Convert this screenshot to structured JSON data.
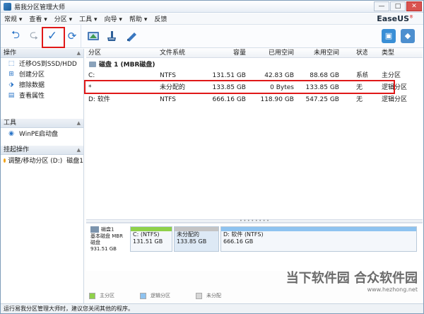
{
  "window": {
    "title": "易我分区管理大师",
    "controls": [
      "—",
      "□",
      "✕"
    ]
  },
  "menu": [
    "常规 ▾",
    "查看 ▾",
    "分区 ▾",
    "工具 ▾",
    "向导 ▾",
    "帮助 ▾",
    "反馈"
  ],
  "brand": {
    "name": "EaseUS",
    "mark": "®"
  },
  "toolbar": {
    "undo": "⮌",
    "redo": "⮎",
    "apply": "✓",
    "refresh": "⟳",
    "icons": [
      "partition-icon",
      "wipe-icon",
      "settings-icon"
    ],
    "right_icons": [
      "upgrade-icon",
      "info-icon"
    ]
  },
  "sidebar": {
    "operations_header": "操作",
    "operations": [
      {
        "icon": "migrate-icon",
        "label": "迁移OS到SSD/HDD"
      },
      {
        "icon": "create-icon",
        "label": "创建分区"
      },
      {
        "icon": "wipe-icon",
        "label": "擦除数据"
      },
      {
        "icon": "properties-icon",
        "label": "查看属性"
      }
    ],
    "tools_header": "工具",
    "tools": [
      {
        "icon": "winpe-icon",
        "label": "WinPE启动盘"
      }
    ],
    "pending_header": "挂起操作",
    "pending": [
      {
        "label": "调整/移动分区 (D:)",
        "target": "磁盘1"
      }
    ]
  },
  "table": {
    "headers": [
      "分区",
      "文件系统",
      "容量",
      "已用空间",
      "未用空间",
      "状态",
      "类型"
    ],
    "disk_label": "磁盘 1 (MBR磁盘)",
    "rows": [
      [
        "C:",
        "NTFS",
        "131.51 GB",
        "42.83 GB",
        "88.68 GB",
        "系统",
        "主分区"
      ],
      [
        "*",
        "未分配的",
        "133.85 GB",
        "0 Bytes",
        "133.85 GB",
        "无",
        "逻辑分区"
      ],
      [
        "D: 软件",
        "NTFS",
        "666.16 GB",
        "118.90 GB",
        "547.25 GB",
        "无",
        "逻辑分区"
      ]
    ]
  },
  "diskmap": {
    "disk": {
      "name": "磁盘1",
      "type": "基本磁盘",
      "style": "MBR磁盘",
      "size": "931.51 GB"
    },
    "blocks": [
      {
        "label": "C: (NTFS)",
        "size": "131.51 GB",
        "kind": "primary"
      },
      {
        "label": "未分配的",
        "size": "133.85 GB",
        "kind": "unalloc"
      },
      {
        "label": "D: 软件 (NTFS)",
        "size": "666.16 GB",
        "kind": "logical"
      }
    ]
  },
  "legend": [
    "主分区",
    "逻辑分区",
    "未分配"
  ],
  "status": "运行易我分区管理大师时，建议您关闭其他的程序。",
  "watermark": {
    "text": "当下软件园 合众软件园",
    "url": "www.hezhong.net"
  }
}
